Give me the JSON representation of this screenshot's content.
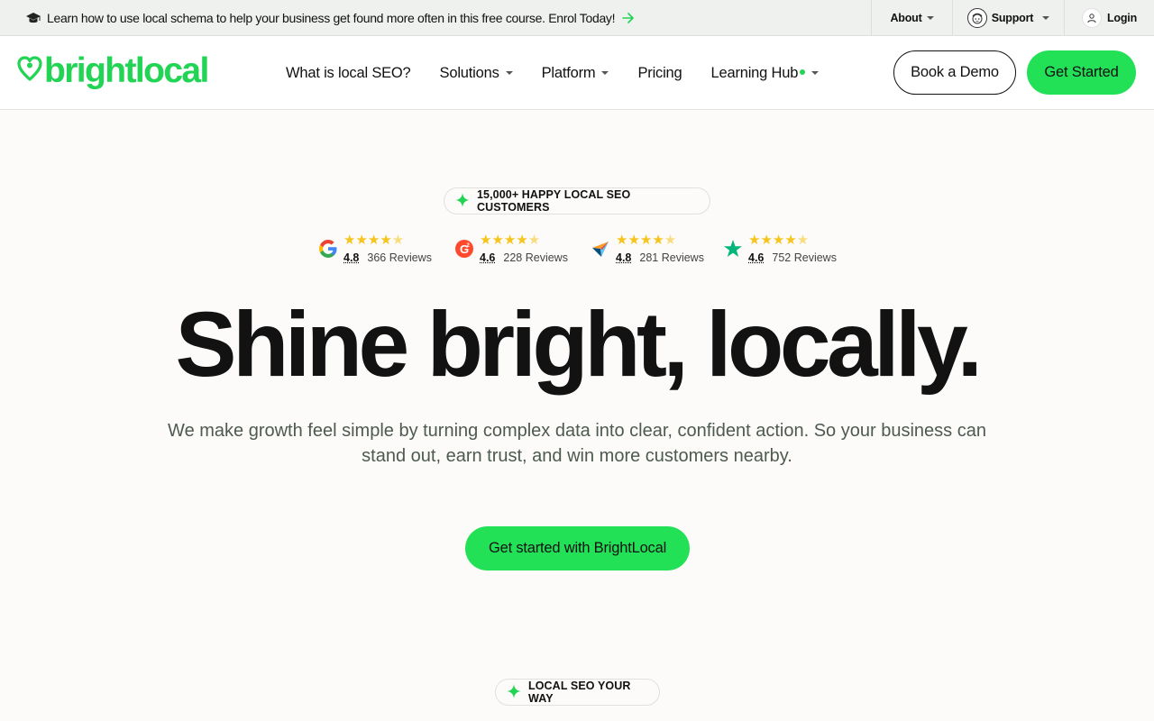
{
  "topbar": {
    "promo_text": "Learn how to use local schema to help your business get found more often in this free course. Enrol Today!",
    "about": "About",
    "support": "Support",
    "login": "Login"
  },
  "nav": {
    "logo_text": "brightlocal",
    "items": [
      {
        "label": "What is local SEO?",
        "dropdown": false
      },
      {
        "label": "Solutions",
        "dropdown": true
      },
      {
        "label": "Platform",
        "dropdown": true
      },
      {
        "label": "Pricing",
        "dropdown": false
      },
      {
        "label": "Learning Hub",
        "dropdown": true
      }
    ],
    "book_demo": "Book a Demo",
    "get_started": "Get Started"
  },
  "hero": {
    "badge": "15,000+ HAPPY LOCAL SEO CUSTOMERS",
    "ratings": [
      {
        "source_icon": "google-icon",
        "stars": 4.5,
        "score": "4.8",
        "reviews": "366 Reviews"
      },
      {
        "source_icon": "g2-icon",
        "stars": 4.5,
        "score": "4.6",
        "reviews": "228 Reviews"
      },
      {
        "source_icon": "capterra-icon",
        "stars": 4.5,
        "score": "4.8",
        "reviews": "281 Reviews"
      },
      {
        "source_icon": "trustpilot-icon",
        "stars": 4.5,
        "score": "4.6",
        "reviews": "752 Reviews"
      }
    ],
    "headline": "Shine bright, locally.",
    "subheadline_line1": "We make growth feel simple by turning complex data into clear, confident action. So your business can",
    "subheadline_line2": "stand out, earn trust, and win more customers nearby.",
    "cta": "Get started with BrightLocal"
  },
  "section_badge": "LOCAL SEO YOUR WAY",
  "colors": {
    "brand_green": "#22d454",
    "button_green": "#23e157",
    "star_yellow": "#f6c41a",
    "background": "#fcfbf9"
  }
}
